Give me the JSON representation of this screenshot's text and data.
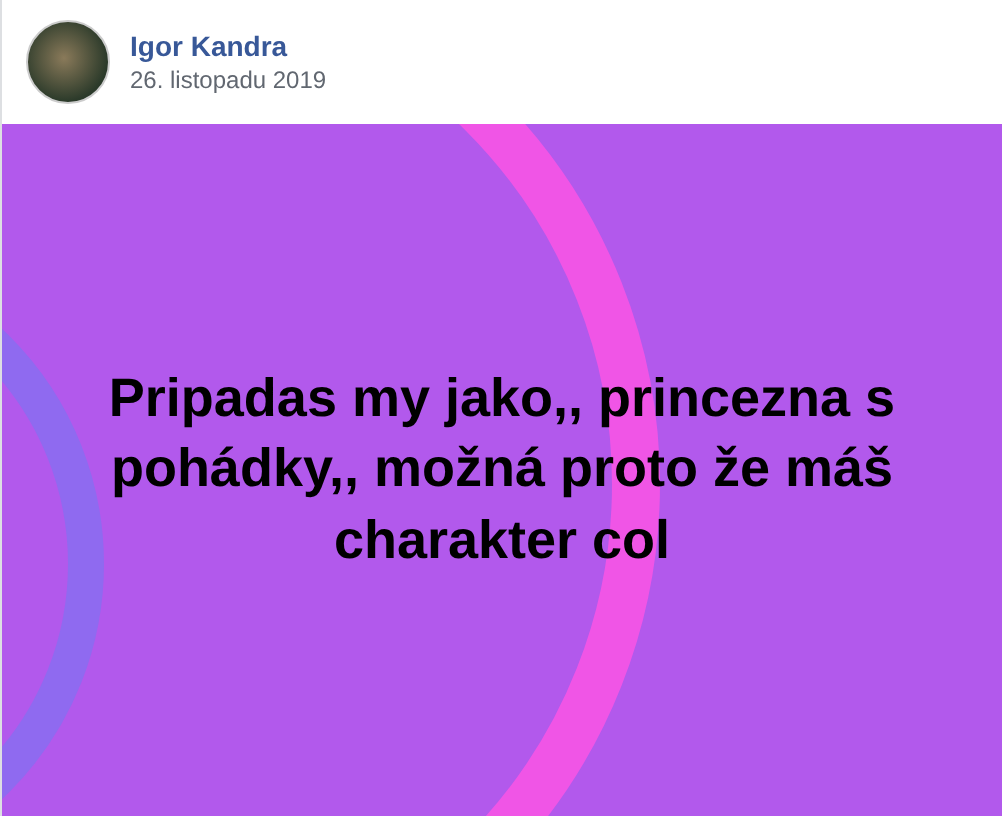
{
  "author": {
    "name": "Igor Kandra",
    "date": "26. listopadu 2019"
  },
  "post": {
    "text": "Pripadas my jako,, princezna s pohádky,, možná proto že máš charakter col"
  }
}
